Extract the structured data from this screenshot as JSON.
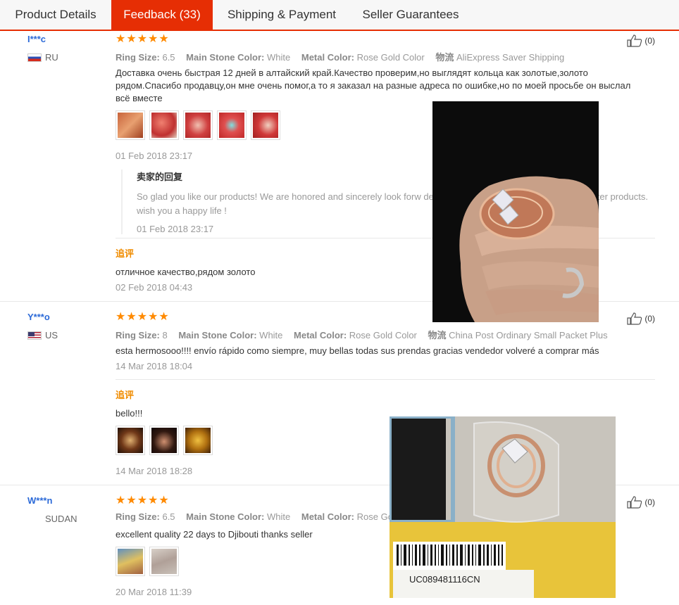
{
  "tabs": [
    {
      "label": "Product Details",
      "active": false
    },
    {
      "label": "Feedback (33)",
      "active": true
    },
    {
      "label": "Shipping & Payment",
      "active": false
    },
    {
      "label": "Seller Guarantees",
      "active": false
    }
  ],
  "colors": {
    "accent": "#e62e04",
    "star": "#ff8a00",
    "user": "#2c6ad8",
    "additional": "#f08c00"
  },
  "stars": "★★★★★",
  "reviews": [
    {
      "user": "I***c",
      "country": "RU",
      "helpful": "(0)",
      "attrs": {
        "ring_size_label": "Ring Size:",
        "ring_size": "6.5",
        "stone_label": "Main Stone Color:",
        "stone": "White",
        "metal_label": "Metal Color:",
        "metal": "Rose Gold Color",
        "ship_label": "物流",
        "ship": "AliExpress Saver Shipping"
      },
      "text": "Доставка очень быстрая 12 дней в алтайский край.Качество проверим,но выглядят кольца как золотые,золото рядом.Спасибо продавцу,он мне очень помог,а то я заказал на разные адреса по ошибке,но по моей просьбе он выслал всё вместе",
      "date": "01 Feb 2018 23:17",
      "reply": {
        "title": "卖家的回复",
        "text": "So glad you like our products! We are honored and sincerely look forw                                              der to repay your support and love with better products. wish you a happy life !",
        "date": "01 Feb 2018 23:17"
      },
      "additional": {
        "label": "追评",
        "text": "отличное качество,рядом золото",
        "date": "02 Feb 2018 04:43"
      }
    },
    {
      "user": "Y***o",
      "country": "US",
      "helpful": "(0)",
      "attrs": {
        "ring_size_label": "Ring Size:",
        "ring_size": "8",
        "stone_label": "Main Stone Color:",
        "stone": "White",
        "metal_label": "Metal Color:",
        "metal": "Rose Gold Color",
        "ship_label": "物流",
        "ship": "China Post Ordinary Small Packet Plus"
      },
      "text": "esta hermosooo!!!! envío rápido como siempre, muy bellas todas sus prendas gracias vendedor volveré a comprar más",
      "date": "14 Mar 2018 18:04",
      "additional": {
        "label": "追评",
        "text": "bello!!!",
        "date": "14 Mar 2018 18:28"
      }
    },
    {
      "user": "W***n",
      "country": "SUDAN",
      "helpful": "(0)",
      "attrs": {
        "ring_size_label": "Ring Size:",
        "ring_size": "6.5",
        "stone_label": "Main Stone Color:",
        "stone": "White",
        "metal_label": "Metal Color:",
        "metal": "Rose Gold"
      },
      "text": "excellent quality 22 days to Djibouti thanks seller",
      "date": "20 Mar 2018 11:39"
    }
  ],
  "popup2_label": "UC089481116CN"
}
